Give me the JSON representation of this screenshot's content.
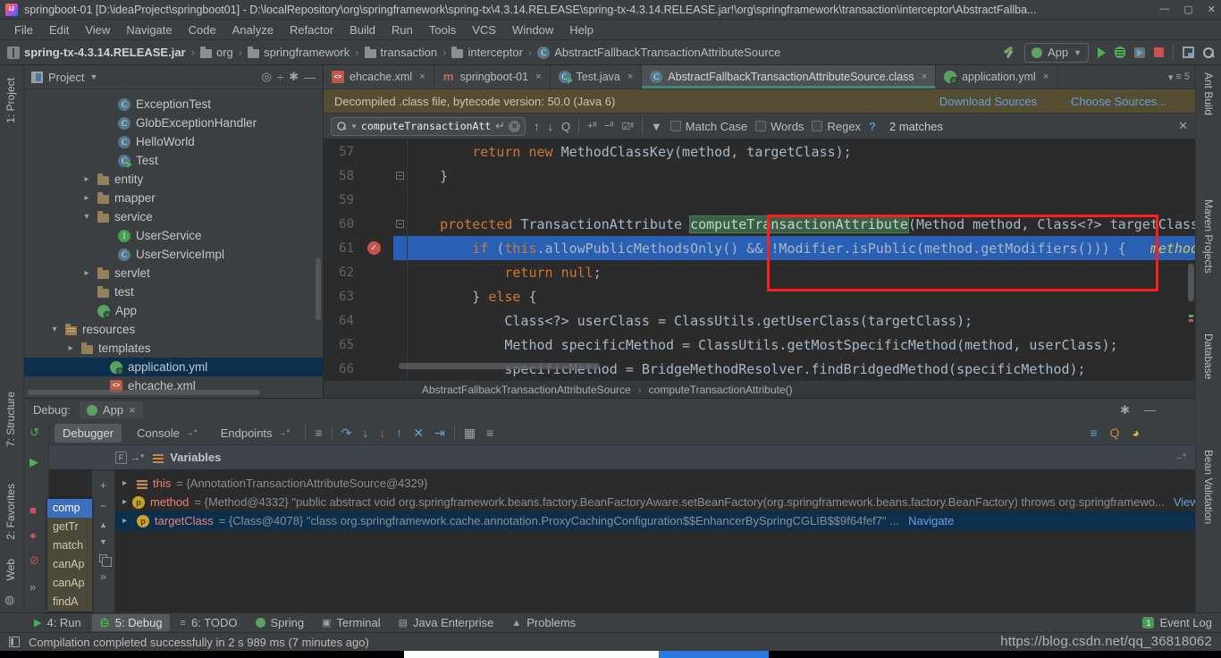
{
  "window": {
    "title": "springboot-01 [D:\\ideaProject\\springboot01] - D:\\localRepository\\org\\springframework\\spring-tx\\4.3.14.RELEASE\\spring-tx-4.3.14.RELEASE.jar!\\org\\springframework\\transaction\\interceptor\\AbstractFallba...",
    "controls": {
      "minimize": "—",
      "maximize": "▢",
      "close": "✕"
    }
  },
  "menu": {
    "items": [
      "File",
      "Edit",
      "View",
      "Navigate",
      "Code",
      "Analyze",
      "Refactor",
      "Build",
      "Run",
      "Tools",
      "VCS",
      "Window",
      "Help"
    ]
  },
  "navbar": {
    "breadcrumbs": [
      {
        "icon": "jar",
        "label": "spring-tx-4.3.14.RELEASE.jar"
      },
      {
        "icon": "package",
        "label": "org"
      },
      {
        "icon": "package",
        "label": "springframework"
      },
      {
        "icon": "package",
        "label": "transaction"
      },
      {
        "icon": "package",
        "label": "interceptor"
      },
      {
        "icon": "class",
        "label": "AbstractFallbackTransactionAttributeSource"
      }
    ],
    "run_config": "App"
  },
  "left_stripe": {
    "project": "1: Project",
    "structure": "7: Structure",
    "favorites": "2: Favorites",
    "web": "Web"
  },
  "right_stripe": {
    "items": [
      "Ant Build",
      "Maven Projects",
      "Database",
      "Bean Validation"
    ]
  },
  "project": {
    "header": "Project",
    "tree": [
      {
        "label": "ExceptionTest",
        "icon": "class",
        "indent": "i5"
      },
      {
        "label": "GlobExceptionHandler",
        "icon": "class",
        "indent": "i5"
      },
      {
        "label": "HelloWorld",
        "icon": "class",
        "indent": "i5"
      },
      {
        "label": "Test",
        "icon": "class-run",
        "indent": "i5"
      },
      {
        "label": "entity",
        "icon": "folder",
        "chevron": "right",
        "indent": "i4"
      },
      {
        "label": "mapper",
        "icon": "folder",
        "chevron": "right",
        "indent": "i4"
      },
      {
        "label": "service",
        "icon": "folder",
        "chevron": "down",
        "indent": "i4"
      },
      {
        "label": "UserService",
        "icon": "interface",
        "indent": "i5"
      },
      {
        "label": "UserServiceImpl",
        "icon": "class",
        "indent": "i5"
      },
      {
        "label": "servlet",
        "icon": "folder",
        "chevron": "right",
        "indent": "i4"
      },
      {
        "label": "test",
        "icon": "folder",
        "indent": "i4"
      },
      {
        "label": "App",
        "icon": "spring",
        "indent": "i4"
      },
      {
        "label": "resources",
        "icon": "resources",
        "chevron": "down",
        "indent": "i3"
      },
      {
        "label": "templates",
        "icon": "folder",
        "chevron": "right",
        "indent": "i35"
      },
      {
        "label": "application.yml",
        "icon": "spring",
        "indent": "i45",
        "selected": true
      },
      {
        "label": "ehcache.xml",
        "icon": "xml",
        "indent": "i45"
      }
    ]
  },
  "editor": {
    "tabs": [
      {
        "label": "ehcache.xml",
        "icon": "xml"
      },
      {
        "label": "springboot-01",
        "icon": "maven"
      },
      {
        "label": "Test.java",
        "icon": "class-run"
      },
      {
        "label": "AbstractFallbackTransactionAttributeSource.class",
        "icon": "class",
        "active": true
      },
      {
        "label": "application.yml",
        "icon": "spring"
      }
    ],
    "tab_overflow": "5",
    "banner": {
      "text": "Decompiled .class file, bytecode version: 50.0 (Java 6)",
      "links": [
        "Download Sources",
        "Choose Sources..."
      ]
    },
    "search": {
      "query": "computeTransactionAttribute",
      "options": [
        "Match Case",
        "Words",
        "Regex"
      ],
      "help": "?",
      "matches": "2 matches"
    },
    "code": {
      "lines": [
        {
          "num": "57",
          "seg": [
            [
              "        ",
              "p"
            ],
            [
              "return ",
              "k"
            ],
            [
              "new ",
              "k"
            ],
            [
              "MethodClassKey(method, targetClass);",
              "p"
            ]
          ]
        },
        {
          "num": "58",
          "seg": [
            [
              "    }",
              "p"
            ]
          ],
          "fold": true
        },
        {
          "num": "59",
          "seg": []
        },
        {
          "num": "60",
          "seg": [
            [
              "    ",
              "p"
            ],
            [
              "protected ",
              "k"
            ],
            [
              "TransactionAttribute ",
              "p"
            ],
            [
              "computeTransactionAttribute",
              "match"
            ],
            [
              "(Method method, Class<?> targetClass) {",
              "p"
            ]
          ],
          "fold": true
        },
        {
          "num": "61",
          "seg": [
            [
              "        ",
              "p"
            ],
            [
              "if ",
              "k"
            ],
            [
              "(",
              "p"
            ],
            [
              "this",
              "k"
            ],
            [
              ".allowPublicMethodsOnly() && !Modifier.isPublic(method.getModifiers())) {   ",
              "p"
            ],
            [
              "method...",
              "hint"
            ]
          ],
          "exec": true,
          "breakpoint": true
        },
        {
          "num": "62",
          "seg": [
            [
              "            ",
              "p"
            ],
            [
              "return null",
              "k"
            ],
            [
              ";",
              "p"
            ]
          ]
        },
        {
          "num": "63",
          "seg": [
            [
              "        } ",
              "p"
            ],
            [
              "else ",
              "k"
            ],
            [
              "{",
              "p"
            ]
          ]
        },
        {
          "num": "64",
          "seg": [
            [
              "            Class<?> userClass = ClassUtils.getUserClass(targetClass);",
              "p"
            ]
          ]
        },
        {
          "num": "65",
          "seg": [
            [
              "            Method specificMethod = ClassUtils.getMostSpecificMethod(method, userClass);",
              "p"
            ]
          ]
        },
        {
          "num": "66",
          "seg": [
            [
              "            specificMethod = BridgeMethodResolver.findBridgedMethod(specificMethod);",
              "p"
            ]
          ]
        }
      ]
    },
    "breadcrumb": [
      "AbstractFallbackTransactionAttributeSource",
      "computeTransactionAttribute()"
    ]
  },
  "debug": {
    "label": "Debug:",
    "session": {
      "name": "App",
      "close": "×"
    },
    "tool_tabs": [
      {
        "label": "Debugger",
        "active": true
      },
      {
        "label": "Console"
      },
      {
        "label": "Endpoints"
      }
    ],
    "frames": [
      "comp",
      "getTr",
      "match",
      "canAp",
      "canAp",
      "findA"
    ],
    "frames_tab_label": "F",
    "variables_header": "Variables",
    "variables": [
      {
        "icon": "value",
        "name": "this",
        "value": "= {AnnotationTransactionAttributeSource@4329}"
      },
      {
        "icon": "param",
        "name": "method",
        "value": "= {Method@4332} \"public abstract void org.springframework.beans.factory.BeanFactoryAware.setBeanFactory(org.springframework.beans.factory.BeanFactory) throws org.springframewo...",
        "link": "View"
      },
      {
        "icon": "param",
        "name": "targetClass",
        "value": "= {Class@4078} \"class org.springframework.cache.annotation.ProxyCachingConfiguration$$EnhancerBySpringCGLIB$$9f64fef7\" ...",
        "link": "Navigate",
        "selected": true
      }
    ]
  },
  "bottom_bar": {
    "items": [
      {
        "label": "4: Run",
        "icon": "play"
      },
      {
        "label": "5: Debug",
        "icon": "bug",
        "active": true
      },
      {
        "label": "6: TODO",
        "icon": "todo"
      },
      {
        "label": "Spring",
        "icon": "leaf"
      },
      {
        "label": "Terminal",
        "icon": "terminal"
      },
      {
        "label": "Java Enterprise",
        "icon": "je"
      },
      {
        "label": "Problems",
        "icon": "warn"
      }
    ],
    "right": {
      "label": "Event Log",
      "badge": "1"
    }
  },
  "status_bar": {
    "message": "Compilation completed successfully in 2 s 989 ms (7 minutes ago)",
    "watermark": "https://blog.csdn.net/qq_36818062"
  },
  "colors": {
    "annotation_red": "#ff1d1d",
    "exec_line_blue": "#2a60b4",
    "search_match_green": "#3a6148"
  }
}
